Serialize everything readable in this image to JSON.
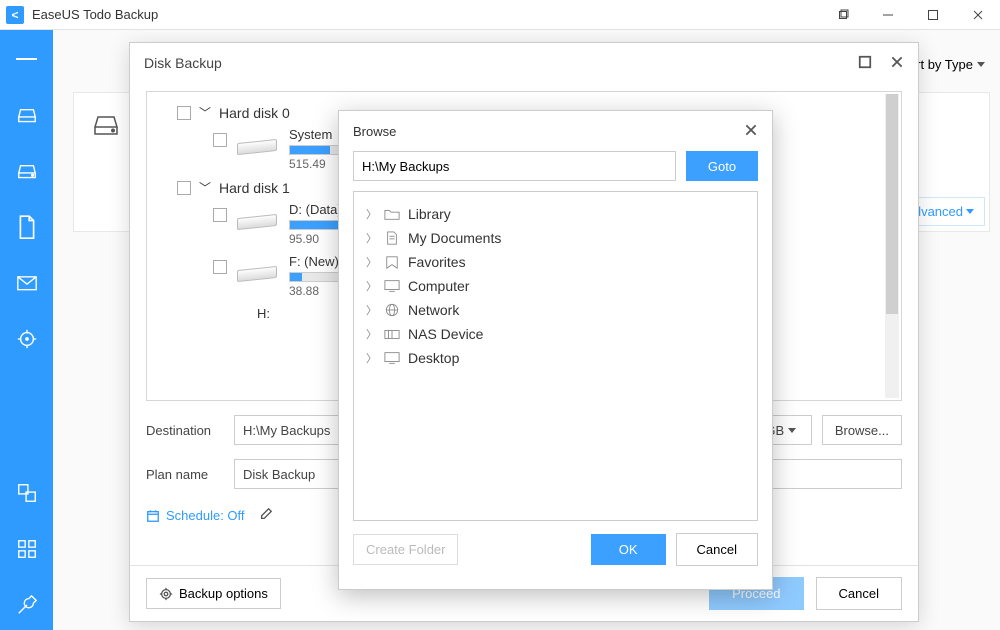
{
  "app": {
    "title": "EaseUS Todo Backup"
  },
  "toolbar": {
    "sort_label": "Sort by Type",
    "advanced_label": "Advanced"
  },
  "diskWindow": {
    "title": "Disk Backup",
    "destination_label": "Destination",
    "destination_value": "H:\\My Backups",
    "unit": "GB",
    "browse_label": "Browse...",
    "plan_label": "Plan name",
    "plan_value": "Disk Backup",
    "schedule_label": "Schedule: Off",
    "backup_options": "Backup options",
    "proceed": "Proceed",
    "cancel": "Cancel",
    "disks": [
      {
        "label": "Hard disk 0"
      },
      {
        "label": "Hard disk 1"
      }
    ],
    "partitions": [
      {
        "name": "System",
        "size": "515.49",
        "fill": 10
      },
      {
        "name": "D: (Data)",
        "size": "95.90",
        "fill": 100
      },
      {
        "name": "F: (New)",
        "size": "38.88",
        "fill": 3
      },
      {
        "name": "H:",
        "size": "",
        "fill": 0
      }
    ]
  },
  "browse": {
    "title": "Browse",
    "path": "H:\\My Backups",
    "goto": "Goto",
    "create_folder": "Create Folder",
    "ok": "OK",
    "cancel": "Cancel",
    "nodes": [
      {
        "icon": "folder",
        "label": "Library"
      },
      {
        "icon": "doc",
        "label": "My Documents"
      },
      {
        "icon": "star",
        "label": "Favorites"
      },
      {
        "icon": "monitor",
        "label": "Computer"
      },
      {
        "icon": "globe",
        "label": "Network"
      },
      {
        "icon": "nas",
        "label": "NAS Device"
      },
      {
        "icon": "monitor",
        "label": "Desktop"
      }
    ]
  }
}
